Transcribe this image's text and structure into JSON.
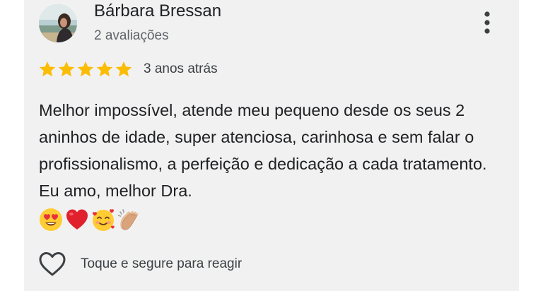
{
  "review": {
    "author_name": "Bárbara Bressan",
    "review_count": "2 avaliações",
    "rating": 5,
    "rating_max": 5,
    "time_ago": "3 anos atrás",
    "text": "Melhor impossível, atende meu pequeno desde os seus 2 aninhos de idade, super atenciosa, carinhosa e sem falar o profissionalismo, a perfeição e dedicação a cada tratamento. Eu amo, melhor Dra.",
    "emojis": [
      "heart-eyes-emoji",
      "red-heart-emoji",
      "smiling-face-with-hearts-emoji",
      "clapping-hands-emoji"
    ]
  },
  "actions": {
    "react_label": "Toque e segure para reagir",
    "react_icon": "heart-outline-icon",
    "more_icon": "more-vertical-icon"
  },
  "colors": {
    "star": "#fbbc04",
    "card_background": "#f1f1f1",
    "text": "#202124",
    "secondary_text": "#5f6368"
  }
}
